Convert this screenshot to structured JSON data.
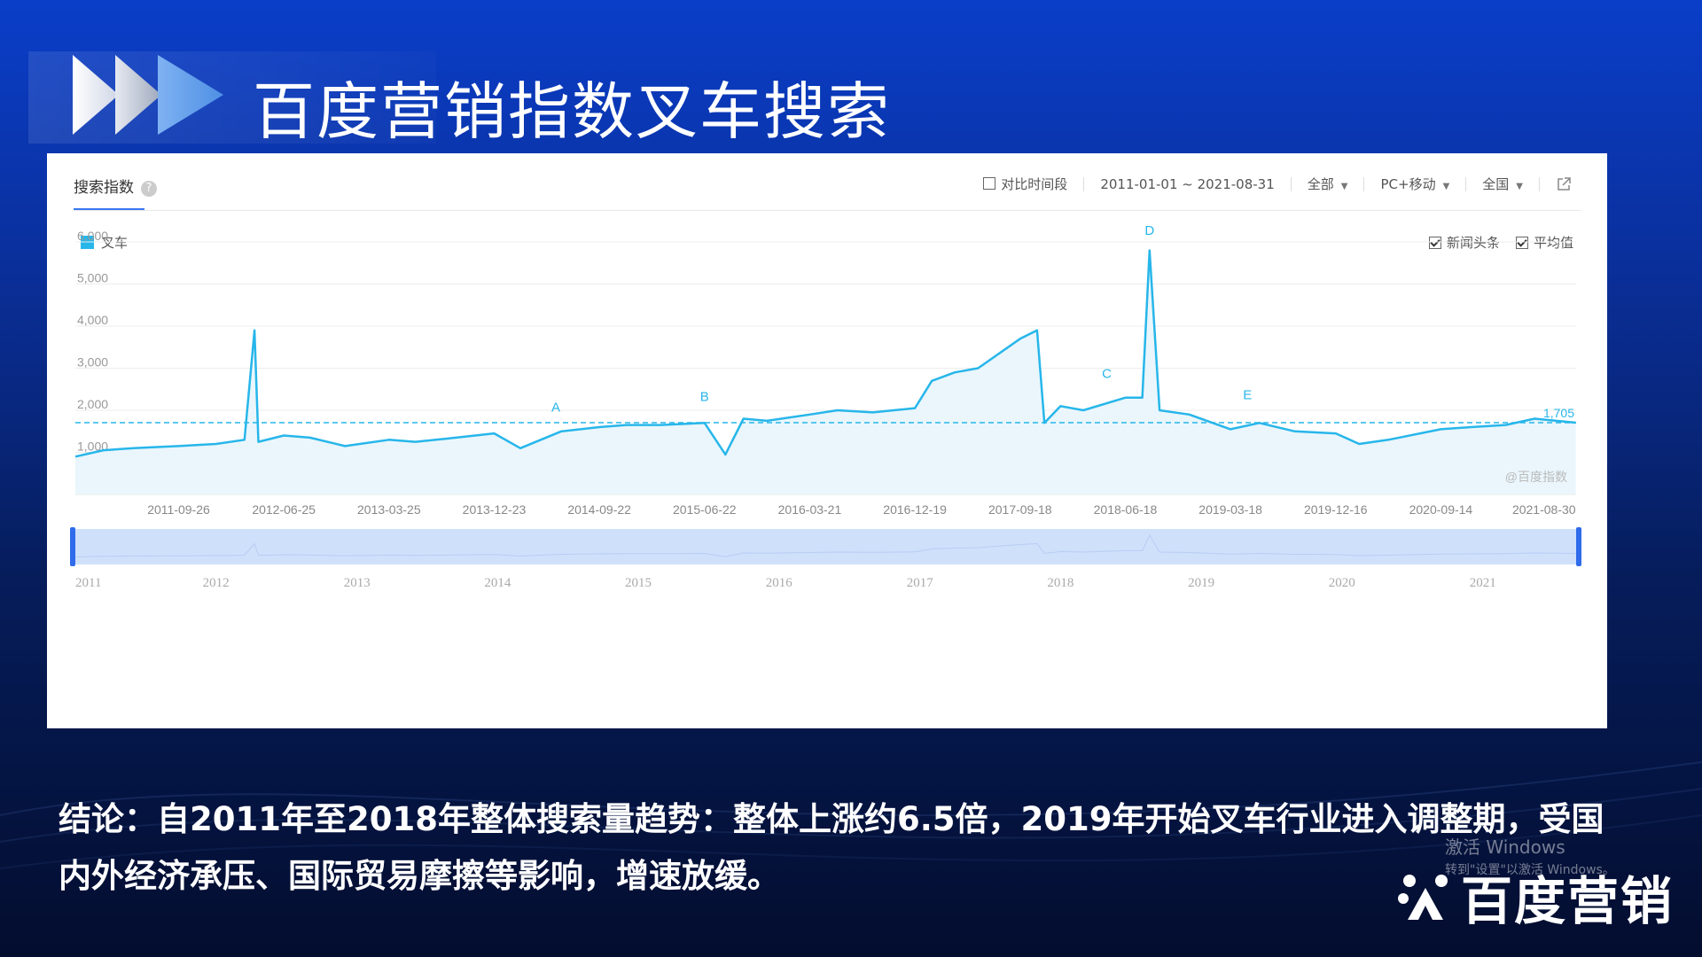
{
  "page": {
    "title": "百度营销指数叉车搜索",
    "conclusion": "结论：自2011年至2018年整体搜索量趋势：整体上涨约6.5倍，2019年开始叉车行业进入调整期，受国内外经济承压、国际贸易摩擦等影响，增速放缓。",
    "watermark_line1": "激活 Windows",
    "watermark_line2": "转到\"设置\"以激活 Windows。",
    "logo_text": "百度营销"
  },
  "panel": {
    "tab_label": "搜索指数",
    "help_icon": "question-icon",
    "compare_label": "对比时间段",
    "date_range": "2011-01-01 ~ 2021-08-31",
    "source_filter": "全部",
    "device_filter": "PC+移动",
    "region_filter": "全国",
    "export_icon": "external-link-icon",
    "legend_label": "叉车",
    "option_news": "新闻头条",
    "option_avg": "平均值",
    "credit": "@百度指数"
  },
  "colors": {
    "line": "#27b6ea",
    "fill": "#eaf6fc",
    "avg": "#27b6ea",
    "slider": "#cfe0fb",
    "handle": "#2f6bea"
  },
  "chart_data": {
    "type": "line",
    "series": [
      {
        "name": "叉车",
        "x": [
          "2011-01-01",
          "2011-03-15",
          "2011-06-01",
          "2011-09-26",
          "2012-01-01",
          "2012-03-15",
          "2012-04-10",
          "2012-04-20",
          "2012-06-25",
          "2012-09-01",
          "2012-12-01",
          "2013-03-25",
          "2013-06-01",
          "2013-09-15",
          "2013-12-23",
          "2014-03-01",
          "2014-06-15",
          "2014-09-22",
          "2014-12-01",
          "2015-03-01",
          "2015-06-22",
          "2015-08-15",
          "2015-10-01",
          "2015-12-01",
          "2016-03-21",
          "2016-06-01",
          "2016-09-01",
          "2016-12-19",
          "2017-02-01",
          "2017-04-01",
          "2017-06-01",
          "2017-09-18",
          "2017-11-01",
          "2017-11-20",
          "2018-01-01",
          "2018-03-01",
          "2018-06-18",
          "2018-08-01",
          "2018-08-20",
          "2018-09-15",
          "2018-12-01",
          "2019-03-18",
          "2019-06-01",
          "2019-09-01",
          "2019-12-16",
          "2020-02-15",
          "2020-05-01",
          "2020-09-14",
          "2020-12-01",
          "2021-03-01",
          "2021-05-15",
          "2021-08-30"
        ],
        "y": [
          900,
          1050,
          1100,
          1150,
          1200,
          1300,
          3900,
          1250,
          1400,
          1350,
          1150,
          1300,
          1250,
          1350,
          1450,
          1100,
          1500,
          1600,
          1650,
          1650,
          1700,
          950,
          1800,
          1750,
          1900,
          2000,
          1950,
          2050,
          2700,
          2900,
          3000,
          3700,
          3900,
          1700,
          2100,
          2000,
          2300,
          2300,
          5800,
          2000,
          1900,
          1550,
          1700,
          1500,
          1450,
          1200,
          1300,
          1550,
          1600,
          1650,
          1800,
          1705
        ]
      }
    ],
    "x_ticks": [
      "2011-09-26",
      "2012-06-25",
      "2013-03-25",
      "2013-12-23",
      "2014-09-22",
      "2015-06-22",
      "2016-03-21",
      "2016-12-19",
      "2017-09-18",
      "2018-06-18",
      "2019-03-18",
      "2019-12-16",
      "2020-09-14",
      "2021-08-30"
    ],
    "y_ticks": [
      "1,000",
      "2,000",
      "3,000",
      "4,000",
      "5,000",
      "6,000"
    ],
    "ylim": [
      0,
      6000
    ],
    "xlim": [
      "2011-01-01",
      "2021-08-31"
    ],
    "average": 1705,
    "average_label": "1,705",
    "annotations": [
      {
        "label": "A",
        "x": "2014-06-01",
        "y": 1800
      },
      {
        "label": "B",
        "x": "2015-06-22",
        "y": 2050
      },
      {
        "label": "C",
        "x": "2018-05-01",
        "y": 2600
      },
      {
        "label": "D",
        "x": "2018-08-20",
        "y": 6000
      },
      {
        "label": "E",
        "x": "2019-05-01",
        "y": 2100
      }
    ],
    "overview_ticks": [
      "2011",
      "2012",
      "2013",
      "2014",
      "2015",
      "2016",
      "2017",
      "2018",
      "2019",
      "2020",
      "2021"
    ],
    "grid": true,
    "legend": "top-left"
  }
}
